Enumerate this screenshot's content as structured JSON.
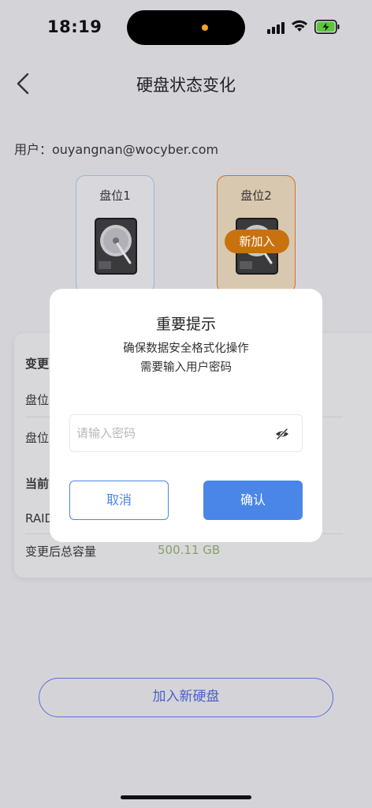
{
  "status_bar": {
    "time": "18:19"
  },
  "nav": {
    "title": "硬盘状态变化",
    "back_icon": "chevron-left-icon"
  },
  "user_line": "用户：ouyangnan@wocyber.com",
  "slots": [
    {
      "label": "盘位1",
      "icon": "hard-disk-icon"
    },
    {
      "label": "盘位2",
      "icon": "hard-disk-icon",
      "badge": "新加入"
    }
  ],
  "info_card": {
    "change_title": "变更",
    "slot1_label": "盘位",
    "slot2_label": "盘位",
    "current_title": "当前",
    "raid_label": "RAID",
    "capacity_label": "变更后总容量",
    "capacity_value": "500.11 GB"
  },
  "add_button": "加入新硬盘",
  "modal": {
    "title": "重要提示",
    "message_line1": "确保数据安全格式化操作",
    "message_line2": "需要输入用户密码",
    "password_placeholder": "请输入密码",
    "password_value": "",
    "eye_icon": "eye-off-icon",
    "cancel_label": "取消",
    "confirm_label": "确认"
  },
  "colors": {
    "accent": "#4a86e8",
    "badge": "#c8720f",
    "capacity": "#8aa06a",
    "add_button_border": "#5b6fd6"
  }
}
